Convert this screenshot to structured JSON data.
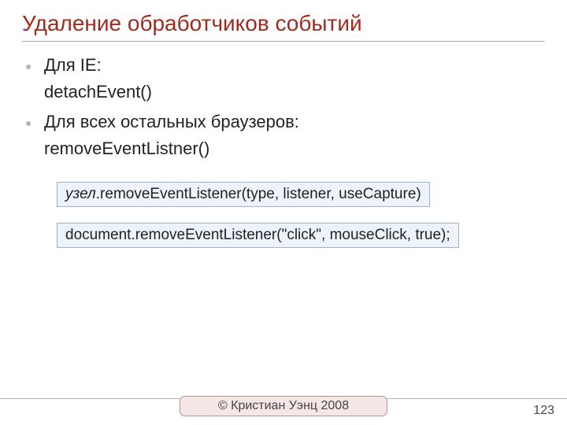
{
  "title": "Удаление обработчиков событий",
  "bullets": {
    "b1": "Для IE:",
    "b1_sub": "detachEvent()",
    "b2": "Для всех остальных браузеров:",
    "b2_sub": "removeEventListner()"
  },
  "code1_prefix": "узел",
  "code1_rest": ".removeEventListener(type, listener, useCapture)",
  "code2": "document.removeEventListener(\"click\", mouseClick, true);",
  "footer": {
    "copyright": "© Кристиан Уэнц 2008",
    "page": "123"
  }
}
